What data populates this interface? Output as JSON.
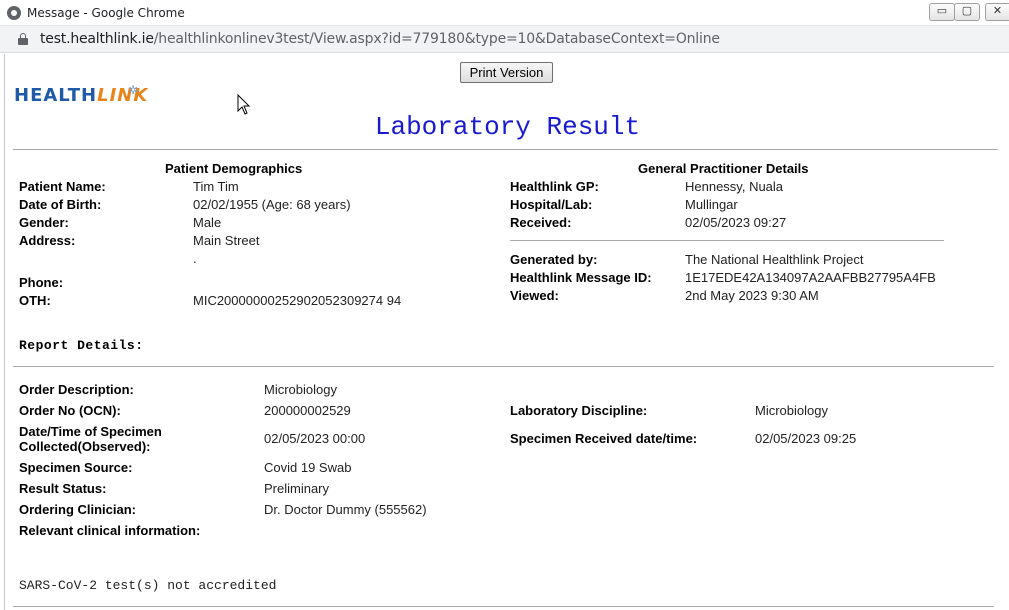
{
  "window": {
    "title": "Message - Google Chrome",
    "min_label": "▭",
    "max_label": "▢",
    "close_label": "✕"
  },
  "address": {
    "host": "test.healthlink.ie",
    "path": "/healthlinkonlinev3test/View.aspx?id=779180&type=10&DatabaseContext=Online"
  },
  "toolbar": {
    "print_label": "Print Version"
  },
  "logo": {
    "part1": "HEALTH",
    "part2": "LINK"
  },
  "report": {
    "title": "Laboratory Result"
  },
  "patient": {
    "heading": "Patient Demographics",
    "rows": [
      {
        "label": "Patient Name:",
        "value": "Tim Tim"
      },
      {
        "label": "Date of Birth:",
        "value": "02/02/1955 (Age: 68 years)"
      },
      {
        "label": "Gender:",
        "value": "Male"
      },
      {
        "label": "Address:",
        "value": "Main Street"
      },
      {
        "label": "",
        "value": "."
      },
      {
        "label": "Phone:",
        "value": ""
      },
      {
        "label": "OTH:",
        "value": "MIC20000000252902052309274 94"
      }
    ]
  },
  "gp": {
    "heading": "General Practitioner Details",
    "rows": [
      {
        "label": "Healthlink GP:",
        "value": "Hennessy, Nuala"
      },
      {
        "label": "Hospital/Lab:",
        "value": "Mullingar"
      },
      {
        "label": "Received:",
        "value": "02/05/2023 09:27"
      },
      {
        "label": "Generated by:",
        "value": "The National Healthlink Project"
      },
      {
        "label": "Healthlink Message ID:",
        "value": "1E17EDE42A134097A2AAFBB27795A4FB"
      },
      {
        "label": "Viewed:",
        "value": "2nd May 2023 9:30 AM"
      }
    ]
  },
  "details": {
    "heading": "Report Details:",
    "left": [
      {
        "label": "Order Description:",
        "value": "Microbiology"
      },
      {
        "label": "Order No (OCN):",
        "value": "200000002529"
      },
      {
        "label": "Date/Time of Specimen",
        "label2": "Collected(Observed):",
        "value": "02/05/2023 00:00"
      },
      {
        "label": "Specimen Source:",
        "value": "Covid 19 Swab"
      },
      {
        "label": "Result Status:",
        "value": "Preliminary"
      },
      {
        "label": "Ordering Clinician:",
        "value": "Dr. Doctor Dummy (555562)"
      },
      {
        "label": "Relevant clinical information:",
        "value": ""
      }
    ],
    "right": [
      {
        "label": "Laboratory Discipline:",
        "value": "Microbiology"
      },
      {
        "label": "Specimen Received date/time:",
        "value": "02/05/2023 09:25"
      }
    ]
  },
  "note": "SARS-CoV-2 test(s) not accredited"
}
